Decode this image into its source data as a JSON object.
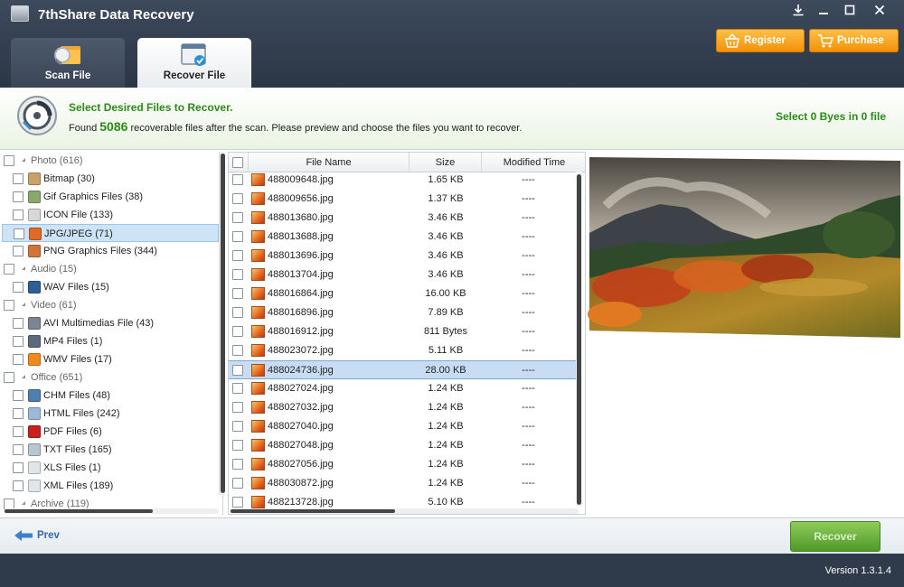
{
  "app": {
    "title": "7thShare Data Recovery",
    "version": "Version 1.3.1.4"
  },
  "tabs": [
    {
      "label": "Scan File"
    },
    {
      "label": "Recover File"
    }
  ],
  "buttons": {
    "register": "Register",
    "purchase": "Purchase",
    "prev": "Prev",
    "recover": "Recover"
  },
  "info": {
    "heading": "Select Desired Files to Recover.",
    "found_prefix": "Found",
    "found_count": "5086",
    "found_suffix": "recoverable files after the scan. Please preview and choose the files you want to recover.",
    "selection": "Select 0 Byes in 0 file"
  },
  "tree": [
    {
      "label": "Photo (616)",
      "level": 0,
      "expanded": true
    },
    {
      "label": "Bitmap (30)",
      "level": 1,
      "icon": "bitmap-icon"
    },
    {
      "label": "Gif Graphics Files (38)",
      "level": 1,
      "icon": "gif-icon"
    },
    {
      "label": "ICON File (133)",
      "level": 1,
      "icon": "ico-icon"
    },
    {
      "label": "JPG/JPEG (71)",
      "level": 1,
      "icon": "jpg-icon",
      "selected": true
    },
    {
      "label": "PNG Graphics Files (344)",
      "level": 1,
      "icon": "png-icon"
    },
    {
      "label": "Audio (15)",
      "level": 0,
      "expanded": true
    },
    {
      "label": "WAV Files (15)",
      "level": 1,
      "icon": "wav-icon"
    },
    {
      "label": "Video (61)",
      "level": 0,
      "expanded": true
    },
    {
      "label": "AVI Multimedias File (43)",
      "level": 1,
      "icon": "avi-icon"
    },
    {
      "label": "MP4 Files (1)",
      "level": 1,
      "icon": "mp4-icon"
    },
    {
      "label": "WMV Files (17)",
      "level": 1,
      "icon": "wmv-icon"
    },
    {
      "label": "Office (651)",
      "level": 0,
      "expanded": true
    },
    {
      "label": "CHM Files (48)",
      "level": 1,
      "icon": "chm-icon"
    },
    {
      "label": "HTML Files (242)",
      "level": 1,
      "icon": "html-icon"
    },
    {
      "label": "PDF Files (6)",
      "level": 1,
      "icon": "pdf-icon"
    },
    {
      "label": "TXT Files (165)",
      "level": 1,
      "icon": "txt-icon"
    },
    {
      "label": "XLS Files (1)",
      "level": 1,
      "icon": "xls-icon"
    },
    {
      "label": "XML Files (189)",
      "level": 1,
      "icon": "xml-icon"
    },
    {
      "label": "Archive (119)",
      "level": 0,
      "expanded": true
    }
  ],
  "file_list": {
    "columns": [
      "File Name",
      "Size",
      "Modified Time"
    ],
    "rows": [
      {
        "name": "488009648.jpg",
        "size": "1.65 KB",
        "modified": "----"
      },
      {
        "name": "488009656.jpg",
        "size": "1.37 KB",
        "modified": "----"
      },
      {
        "name": "488013680.jpg",
        "size": "3.46 KB",
        "modified": "----"
      },
      {
        "name": "488013688.jpg",
        "size": "3.46 KB",
        "modified": "----"
      },
      {
        "name": "488013696.jpg",
        "size": "3.46 KB",
        "modified": "----"
      },
      {
        "name": "488013704.jpg",
        "size": "3.46 KB",
        "modified": "----"
      },
      {
        "name": "488016864.jpg",
        "size": "16.00 KB",
        "modified": "----"
      },
      {
        "name": "488016896.jpg",
        "size": "7.89 KB",
        "modified": "----"
      },
      {
        "name": "488016912.jpg",
        "size": "811 Bytes",
        "modified": "----"
      },
      {
        "name": "488023072.jpg",
        "size": "5.11 KB",
        "modified": "----"
      },
      {
        "name": "488024736.jpg",
        "size": "28.00 KB",
        "modified": "----",
        "selected": true
      },
      {
        "name": "488027024.jpg",
        "size": "1.24 KB",
        "modified": "----"
      },
      {
        "name": "488027032.jpg",
        "size": "1.24 KB",
        "modified": "----"
      },
      {
        "name": "488027040.jpg",
        "size": "1.24 KB",
        "modified": "----"
      },
      {
        "name": "488027048.jpg",
        "size": "1.24 KB",
        "modified": "----"
      },
      {
        "name": "488027056.jpg",
        "size": "1.24 KB",
        "modified": "----"
      },
      {
        "name": "488030872.jpg",
        "size": "1.24 KB",
        "modified": "----"
      },
      {
        "name": "488213728.jpg",
        "size": "5.10 KB",
        "modified": "----"
      }
    ]
  },
  "colors": {
    "accent_green": "#2c8a18",
    "orange": "#f39208",
    "title_bar": "#2f3a4a",
    "selection": "#c8ddf4"
  }
}
